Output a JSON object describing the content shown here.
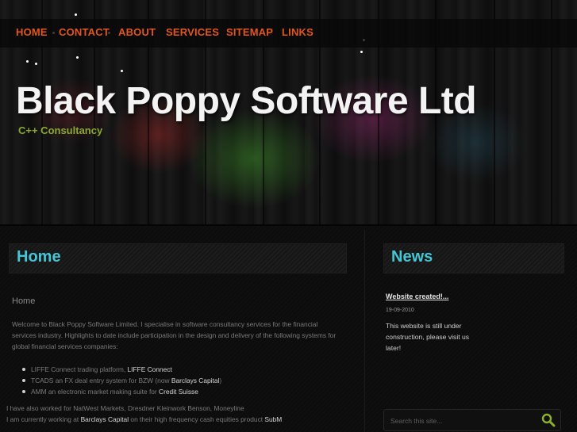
{
  "nav": {
    "items": [
      "HOME",
      "CONTACT",
      "ABOUT",
      "SERVICES",
      "SITEMAP",
      "LINKS"
    ],
    "color": "#e2561e"
  },
  "header": {
    "title": "Black Poppy Software Ltd",
    "tagline": "C++ Consultancy"
  },
  "main": {
    "heading": "Home",
    "breadcrumb": "Home",
    "intro": "Welcome to Black Poppy Software Limited.  I specialise in software consultancy services for the financial services industry.  Highlights to date include participation in the design and delivery of the following systems for global financial services companies:",
    "systems": [
      {
        "text": "LIFFE Connect trading platform, ",
        "client": "LIFFE Connect",
        "suffix": ""
      },
      {
        "text": "TCADS an FX deal entry system for BZW (now ",
        "client": "Barclays Capital",
        "suffix": ")"
      },
      {
        "text": "AMM an electronic market making suite for ",
        "client": "Credit Suisse",
        "suffix": ""
      }
    ],
    "also_worked": "I have also worked for NatWest Markets, Dresdner Kleinwork Benson, Moneyline",
    "current": {
      "prefix": "I am currently working at ",
      "employer": "Barclays Capital",
      "middle": " on their high frequency cash equities product ",
      "product": "SubM"
    }
  },
  "news": {
    "heading": "News",
    "items": [
      {
        "title": "Website created!...",
        "date": "19-09-2010",
        "body": "This website is still under construction, please visit us later!"
      }
    ]
  },
  "search": {
    "placeholder": "Search this site...",
    "icon": "search-icon"
  },
  "colors": {
    "heading": "#44c6d6",
    "tagline": "#8aa834"
  }
}
